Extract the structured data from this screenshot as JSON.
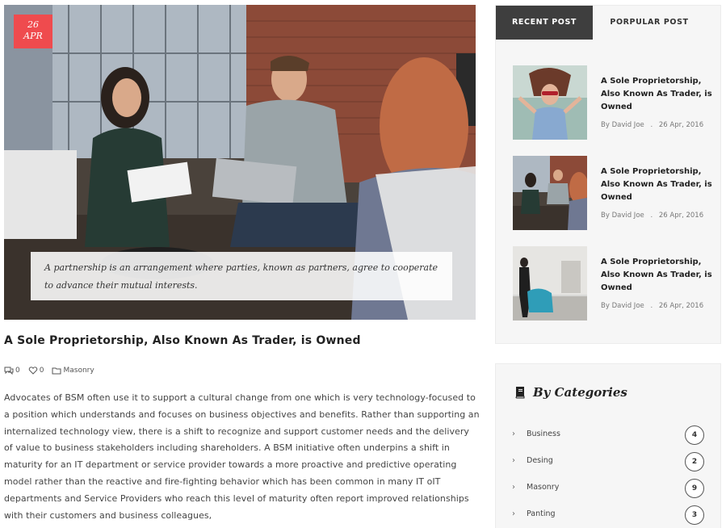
{
  "post": {
    "date_day": "26",
    "date_month": "APR",
    "caption": "A partnership is an arrangement where parties, known as partners, agree to cooperate to advance their mutual interests.",
    "title": "A Sole Proprietorship, Also Known As Trader, is Owned",
    "comments": "0",
    "likes": "0",
    "category": "Masonry",
    "body": "Advocates of BSM often use it to support a cultural change from one which is very technology-focused to a position which understands and focuses on business objectives and benefits. Rather than supporting an internalized technology view, there is a shift to recognize and support customer needs and the delivery of value to business stakeholders including shareholders. A BSM initiative often underpins a shift in maturity for an IT department or service provider towards a more proactive and predictive operating model rather than the reactive and fire-fighting behavior which has been common in many IT oIT departments and Service Providers who reach this level of maturity often report improved relationships with their customers and business colleagues,"
  },
  "sidebar": {
    "tabs": [
      {
        "label": "RECENT POST"
      },
      {
        "label": "PORPULAR POST"
      }
    ],
    "recent_posts": [
      {
        "title": "A Sole Proprietorship, Also Known As Trader, is Owned",
        "author": "By David Joe",
        "sep": ".",
        "date": "26 Apr, 2016"
      },
      {
        "title": "A Sole Proprietorship, Also Known As Trader, is Owned",
        "author": "By David Joe",
        "sep": ".",
        "date": "26 Apr, 2016"
      },
      {
        "title": "A Sole Proprietorship, Also Known As Trader, is Owned",
        "author": "By David Joe",
        "sep": ".",
        "date": "26 Apr, 2016"
      }
    ],
    "categories": {
      "heading": "By Categories",
      "items": [
        {
          "label": "Business",
          "count": "4"
        },
        {
          "label": "Desing",
          "count": "2"
        },
        {
          "label": "Masonry",
          "count": "9"
        },
        {
          "label": "Panting",
          "count": "3"
        }
      ]
    }
  },
  "colors": {
    "accent_red": "#ef4b4e",
    "tab_active": "#3e3e3e",
    "sidebar_bg": "#f6f6f6"
  },
  "icons": [
    "comment-icon",
    "heart-icon",
    "folder-icon",
    "book-icon",
    "chevron-right-icon"
  ]
}
